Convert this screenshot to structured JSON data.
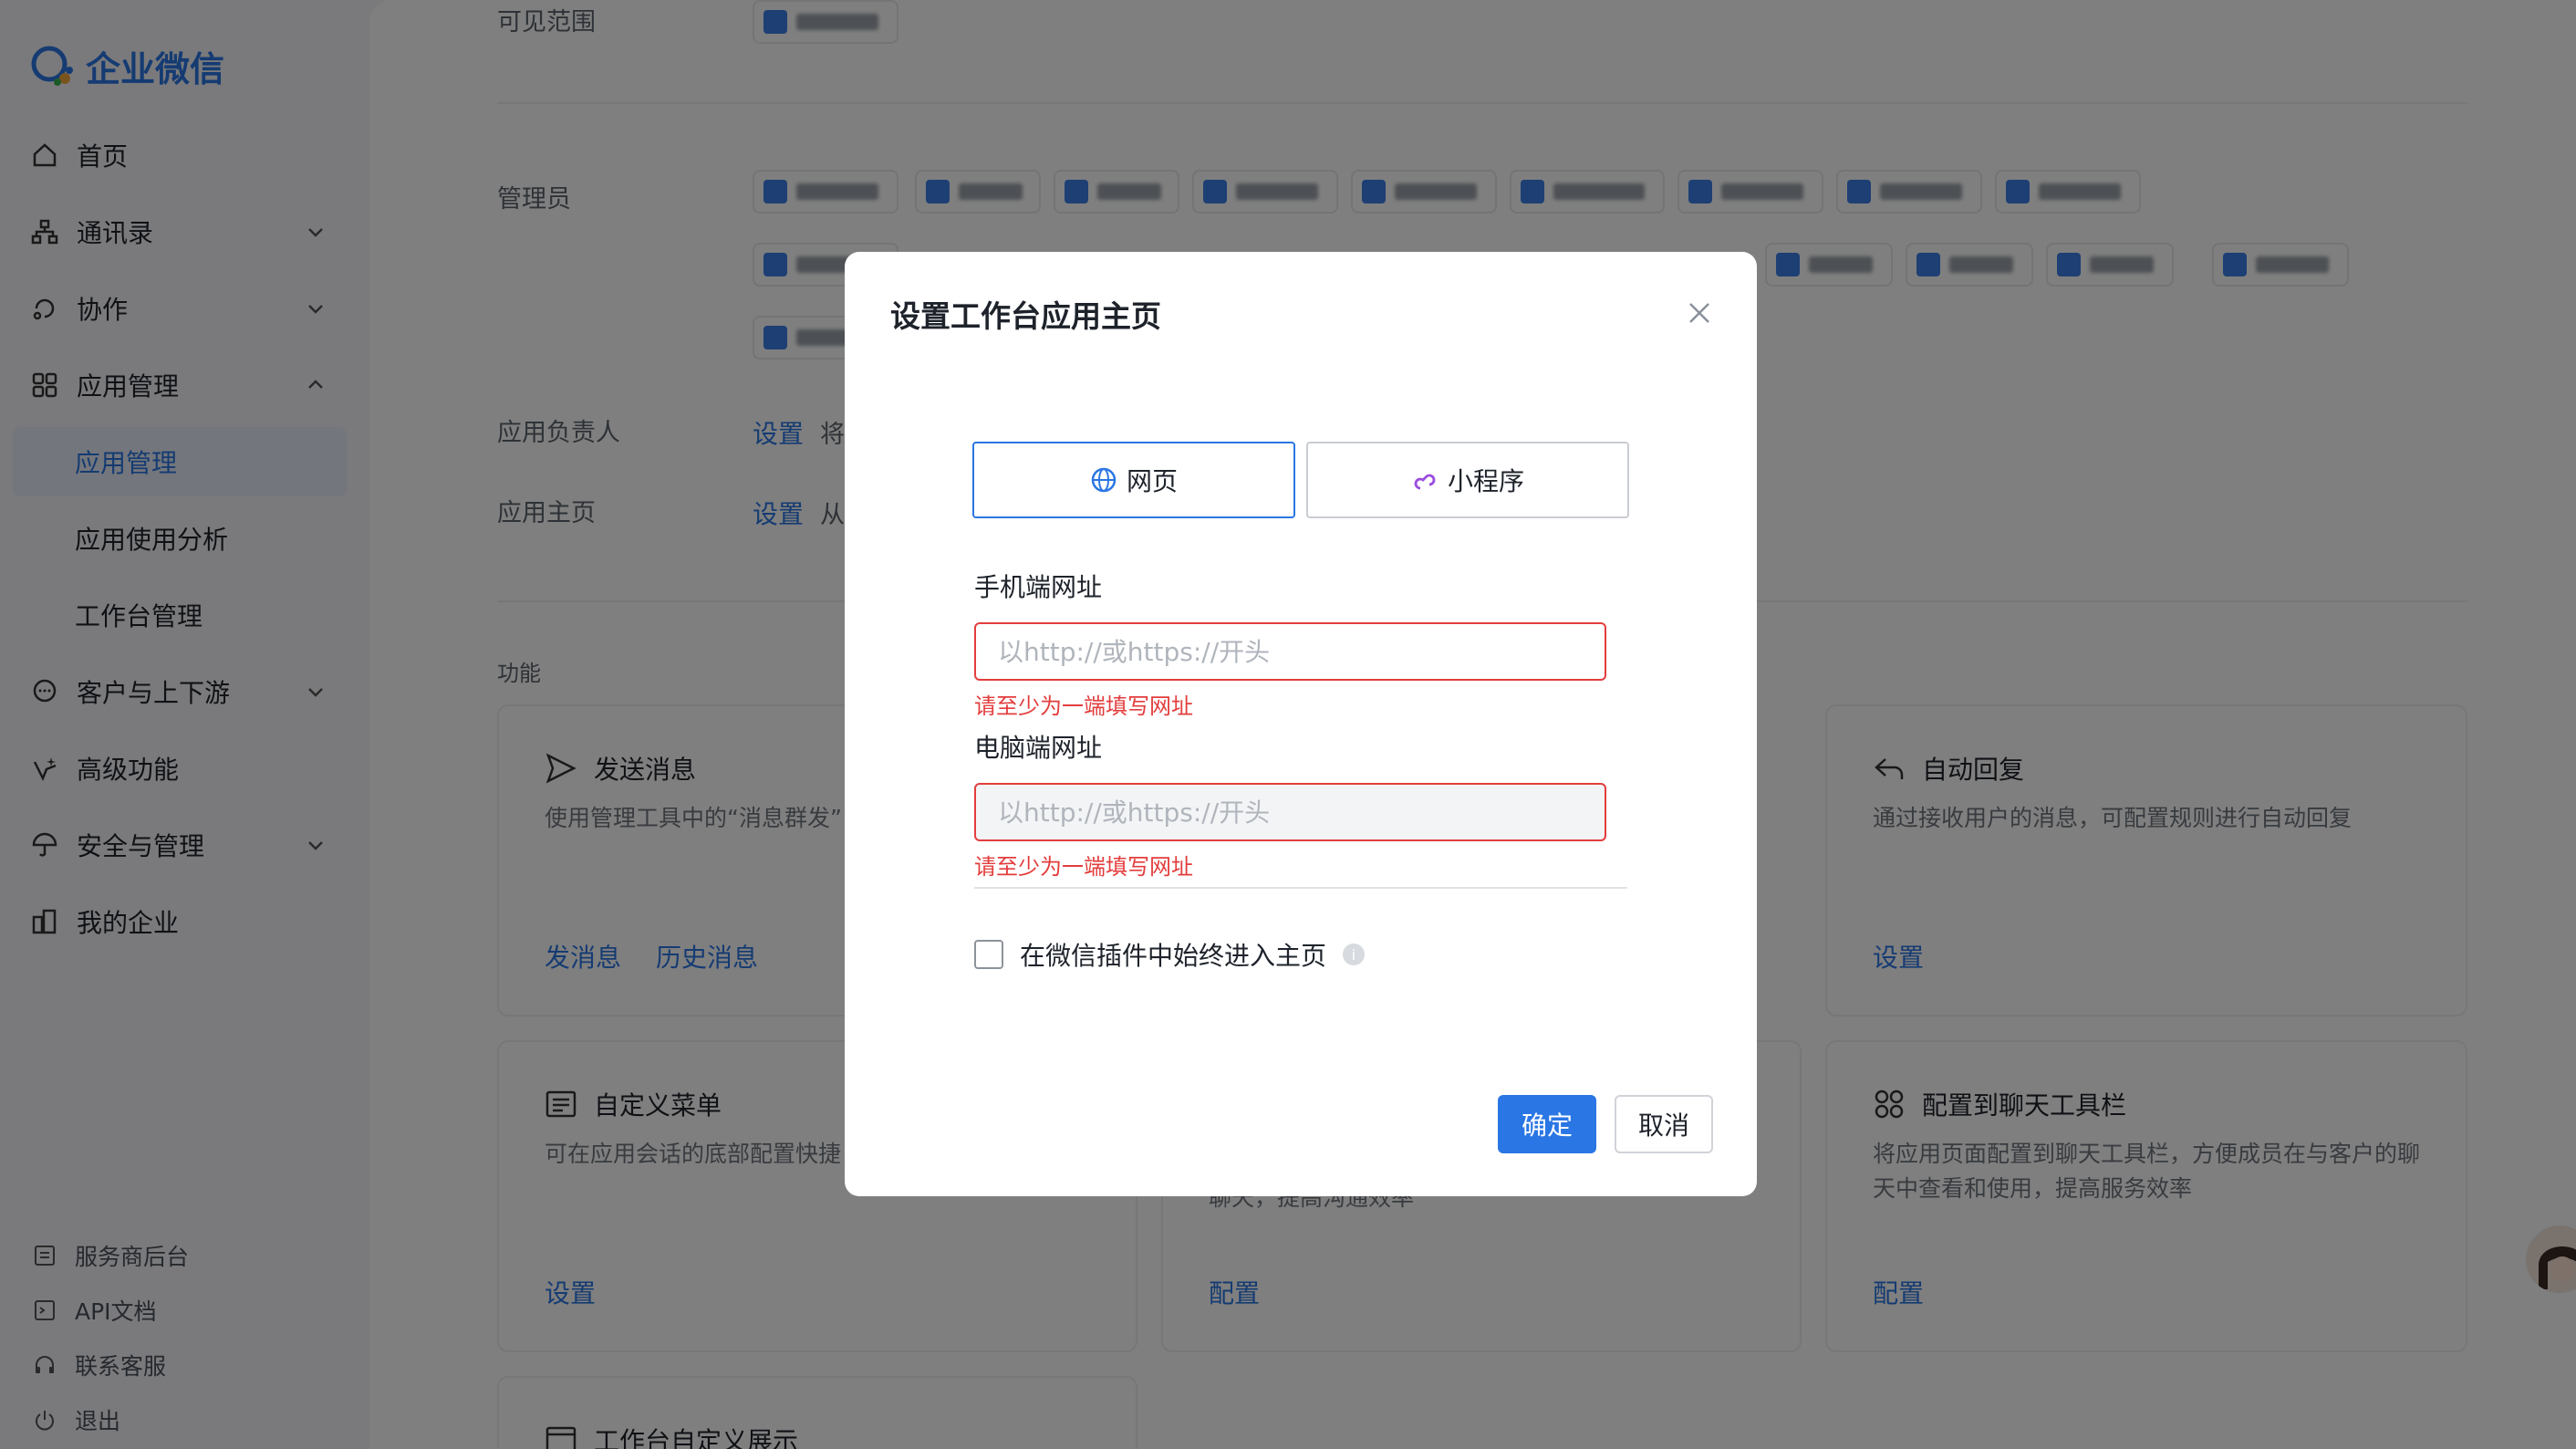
{
  "sidebar": {
    "logo_text": "企业微信",
    "nav": [
      {
        "label": "首页",
        "icon": "home-icon"
      },
      {
        "label": "通讯录",
        "icon": "org-icon"
      },
      {
        "label": "协作",
        "icon": "collab-icon"
      },
      {
        "label": "应用管理",
        "icon": "apps-icon"
      },
      {
        "label": "客户与上下游",
        "icon": "chat-icon"
      },
      {
        "label": "高级功能",
        "icon": "sparkle-icon"
      },
      {
        "label": "安全与管理",
        "icon": "umbrella-icon"
      },
      {
        "label": "我的企业",
        "icon": "building-icon"
      }
    ],
    "sub_items": [
      "应用管理",
      "应用使用分析",
      "工作台管理"
    ],
    "bottom_links": [
      {
        "label": "服务商后台",
        "icon": "doc-icon"
      },
      {
        "label": "API文档",
        "icon": "api-icon"
      },
      {
        "label": "联系客服",
        "icon": "headset-icon"
      },
      {
        "label": "退出",
        "icon": "power-icon"
      }
    ]
  },
  "main": {
    "visible_range_label": "可见范围",
    "admins_label": "管理员",
    "owner_label": "应用负责人",
    "homepage_label": "应用主页",
    "set_link": "设置",
    "owner_hint": "将",
    "homepage_hint": "从",
    "features_label": "功能",
    "cards": [
      {
        "title": "发送消息",
        "icon": "send-icon",
        "desc": "使用管理工具中的“消息群发”",
        "actions": [
          "发消息",
          "历史消息"
        ]
      },
      {
        "title": "自动回复",
        "icon": "reply-icon",
        "desc": "通过接收用户的消息，可配置规则进行自动回复",
        "actions": [
          "设置"
        ]
      },
      {
        "title": "自定义菜单",
        "icon": "menu-icon",
        "desc": "可在应用会话的底部配置快捷",
        "actions": [
          "设置"
        ]
      },
      {
        "title": "",
        "icon": "",
        "desc": "聊天，提高沟通效率",
        "actions": [
          "配置"
        ]
      },
      {
        "title": "配置到聊天工具栏",
        "icon": "toolbar-icon",
        "desc": "将应用页面配置到聊天工具栏，方便成员在与客户的聊天中查看和使用，提高服务效率",
        "actions": [
          "配置"
        ]
      },
      {
        "title": "工作台自定义展示",
        "icon": "dashboard-icon",
        "desc": "",
        "actions": []
      }
    ]
  },
  "modal": {
    "title": "设置工作台应用主页",
    "tabs": [
      {
        "label": "网页",
        "icon": "globe-icon",
        "selected": true
      },
      {
        "label": "小程序",
        "icon": "miniprogram-icon",
        "selected": false
      }
    ],
    "mobile_label": "手机端网址",
    "mobile_placeholder": "以http://或https://开头",
    "mobile_error": "请至少为一端填写网址",
    "pc_label": "电脑端网址",
    "pc_placeholder": "以http://或https://开头",
    "pc_error": "请至少为一端填写网址",
    "checkbox_label": "在微信插件中始终进入主页",
    "info_glyph": "i",
    "confirm": "确定",
    "cancel": "取消"
  },
  "colors": {
    "accent": "#2a76e4",
    "error": "#e33d3d",
    "mini_program": "#9b4dde"
  }
}
